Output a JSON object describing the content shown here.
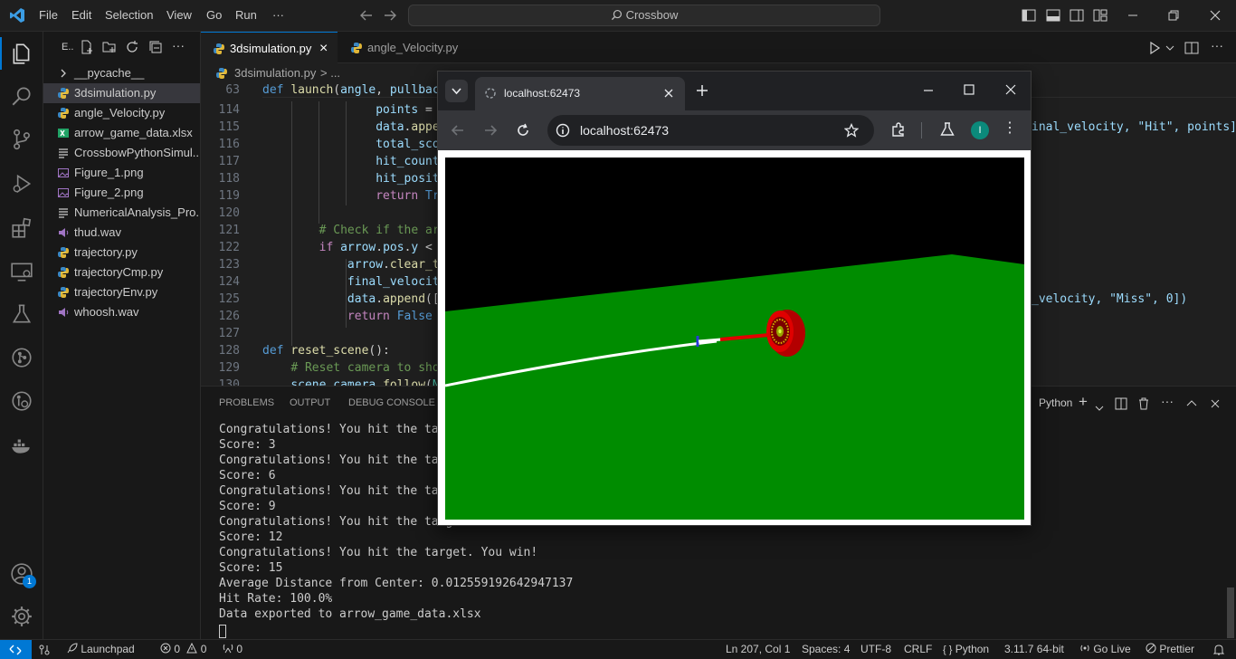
{
  "titlebar": {
    "menus": [
      "File",
      "Edit",
      "Selection",
      "View",
      "Go",
      "Run",
      "···"
    ],
    "command_center": "Crossbow"
  },
  "activity": {
    "badge": "1"
  },
  "sidebar": {
    "header": "E..",
    "files": [
      {
        "name": "__pycache__",
        "type": "folder"
      },
      {
        "name": "3dsimulation.py",
        "type": "python",
        "selected": true
      },
      {
        "name": "angle_Velocity.py",
        "type": "python"
      },
      {
        "name": "arrow_game_data.xlsx",
        "type": "excel"
      },
      {
        "name": "CrossbowPythonSimul...",
        "type": "text"
      },
      {
        "name": "Figure_1.png",
        "type": "image"
      },
      {
        "name": "Figure_2.png",
        "type": "image"
      },
      {
        "name": "NumericalAnalysis_Pro...",
        "type": "text"
      },
      {
        "name": "thud.wav",
        "type": "audio"
      },
      {
        "name": "trajectory.py",
        "type": "python"
      },
      {
        "name": "trajectoryCmp.py",
        "type": "python"
      },
      {
        "name": "trajectoryEnv.py",
        "type": "python"
      },
      {
        "name": "whoosh.wav",
        "type": "audio"
      }
    ]
  },
  "editor": {
    "tabs": [
      {
        "label": "3dsimulation.py",
        "close": "×"
      },
      {
        "label": "angle_Velocity.py"
      }
    ],
    "breadcrumb": {
      "file": "3dsimulation.py",
      "rest": "> ..."
    },
    "line_numbers": [
      "63",
      "114",
      "115",
      "116",
      "117",
      "118",
      "119",
      "120",
      "121",
      "122",
      "123",
      "124",
      "125",
      "126",
      "127",
      "128",
      "129",
      "130"
    ],
    "right_fragments": {
      "line115": "inal_velocity, \"Hit\", points])",
      "line125": "_velocity, \"Miss\", 0])"
    }
  },
  "panel": {
    "tabs": [
      "PROBLEMS",
      "OUTPUT",
      "DEBUG CONSOLE"
    ],
    "terminal_name": "Python",
    "lines": [
      "Congratulations! You hit the target",
      "Score: 3",
      "Congratulations! You hit the target",
      "Score: 6",
      "Congratulations! You hit the target",
      "Score: 9",
      "Congratulations! You hit the target",
      "Score: 12",
      "Congratulations! You hit the target. You win!",
      "Score: 15",
      "Average Distance from Center: 0.012559192642947137",
      "Hit Rate: 100.0%",
      "Data exported to arrow_game_data.xlsx"
    ]
  },
  "statusbar": {
    "launchpad": "Launchpad",
    "problems": "0",
    "warnings": "0",
    "ports": "0",
    "position": "Ln 207, Col 1",
    "spaces": "Spaces: 4",
    "encoding": "UTF-8",
    "eol": "CRLF",
    "language": "Python",
    "interpreter": "3.11.7 64-bit",
    "golive": "Go Live",
    "prettier": "Prettier"
  },
  "browser": {
    "tab_title": "localhost:62473",
    "url": "localhost:62473",
    "profile_initial": "I",
    "colors": {
      "sky": "#000000",
      "ground": "#008c00",
      "target": "#e00000",
      "trail": "#ffffff"
    }
  }
}
